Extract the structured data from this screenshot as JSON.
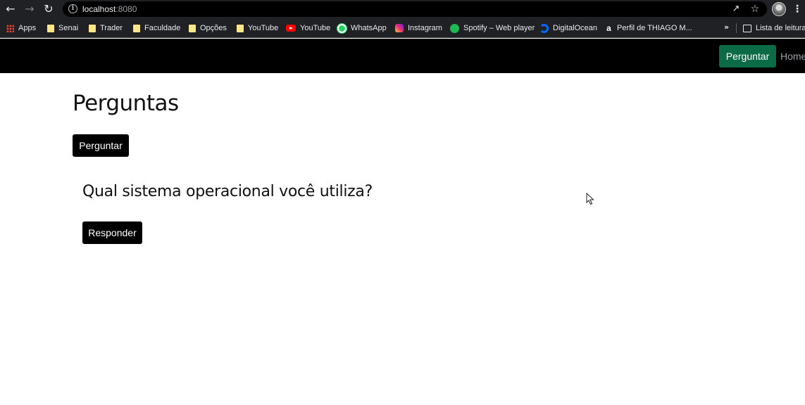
{
  "browser": {
    "url_host": "localhost",
    "url_port": ":8080",
    "bookmarks": [
      {
        "label": "Apps",
        "icon": "apps-grid-icon"
      },
      {
        "label": "Senai",
        "icon": "folder-icon"
      },
      {
        "label": "Trader",
        "icon": "folder-icon"
      },
      {
        "label": "Faculdade",
        "icon": "folder-icon"
      },
      {
        "label": "Opções",
        "icon": "folder-icon"
      },
      {
        "label": "YouTube",
        "icon": "folder-icon"
      },
      {
        "label": "YouTube",
        "icon": "youtube-icon"
      },
      {
        "label": "WhatsApp",
        "icon": "whatsapp-icon"
      },
      {
        "label": "Instagram",
        "icon": "instagram-icon"
      },
      {
        "label": "Spotify – Web player",
        "icon": "spotify-icon"
      },
      {
        "label": "DigitalOcean",
        "icon": "digitalocean-icon"
      },
      {
        "label": "Perfil de THIAGO M...",
        "icon": "amazon-icon"
      }
    ],
    "more_bookmarks": "»",
    "reading_list": "Lista de leitura"
  },
  "navbar": {
    "ask_button": "Perguntar",
    "home_link": "Home"
  },
  "main": {
    "title": "Perguntas",
    "ask_button": "Perguntar",
    "questions": [
      {
        "title": "Qual sistema operacional você utiliza?",
        "answer_button": "Responder"
      }
    ]
  }
}
